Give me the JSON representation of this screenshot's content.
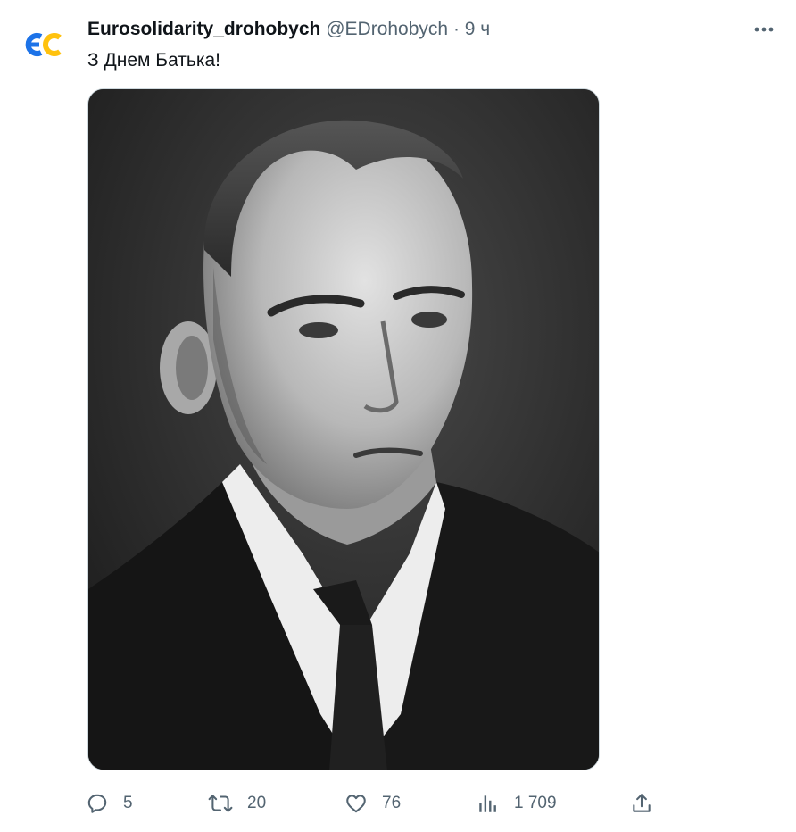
{
  "author": {
    "display_name": "Eurosolidarity_drohobych",
    "handle": "@EDrohobych",
    "separator": "·",
    "time": "9 ч",
    "avatar_text": "ЄС",
    "avatar_colors": {
      "left": "#1d73e8",
      "right": "#ffc20e"
    }
  },
  "tweet": {
    "text": "З Днем Батька!"
  },
  "media": {
    "type": "black-and-white portrait photograph"
  },
  "actions": {
    "reply_count": "5",
    "retweet_count": "20",
    "like_count": "76",
    "views_count": "1 709"
  },
  "icons": {
    "more": "more-icon",
    "reply": "reply-icon",
    "retweet": "retweet-icon",
    "like": "heart-icon",
    "views": "views-icon",
    "share": "share-icon"
  },
  "colors": {
    "text_primary": "#0f1419",
    "text_secondary": "#536471",
    "border": "#cfd9de"
  }
}
